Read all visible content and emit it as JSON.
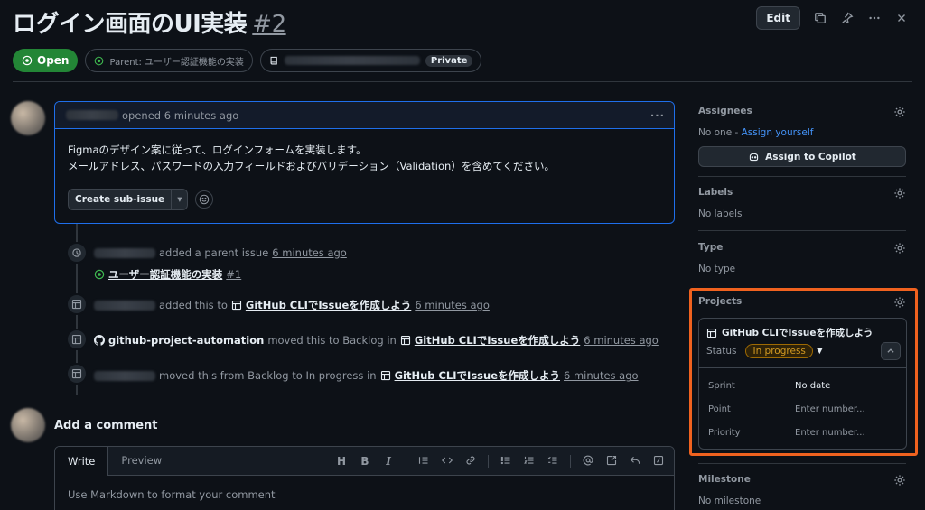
{
  "issue": {
    "title": "ログイン画面のUI実装",
    "number": "#2",
    "state": "Open",
    "parent_label": "Parent: ユーザー認証機能の実装",
    "repo_visibility": "Private"
  },
  "header_actions": {
    "edit_label": "Edit"
  },
  "comment": {
    "opened_text": "opened 6 minutes ago",
    "body_line1": "Figmaのデザイン案に従って、ログインフォームを実装します。",
    "body_line2": "メールアドレス、パスワードの入力フィールドおよびバリデーション（Validation）を含めてください。",
    "create_sub_issue_label": "Create sub-issue"
  },
  "timeline": [
    {
      "action": "added a parent issue",
      "time": "6 minutes ago",
      "sub_link": "ユーザー認証機能の実装",
      "sub_num": "#1"
    },
    {
      "action": "added this to",
      "project": "GitHub CLIでIssueを作成しよう",
      "time": "6 minutes ago"
    },
    {
      "actor": "github-project-automation",
      "action": "moved this to Backlog in",
      "project": "GitHub CLIでIssueを作成しよう",
      "time": "6 minutes ago"
    },
    {
      "action": "moved this from Backlog to In progress in",
      "project": "GitHub CLIでIssueを作成しよう",
      "time": "6 minutes ago"
    }
  ],
  "add_comment": {
    "title": "Add a comment",
    "tab_write": "Write",
    "tab_preview": "Preview",
    "placeholder": "Use Markdown to format your comment",
    "tool_heading": "H",
    "tool_bold": "B",
    "tool_italic": "I"
  },
  "sidebar": {
    "assignees": {
      "title": "Assignees",
      "none_text": "No one - ",
      "assign_link": "Assign yourself",
      "copilot_btn": "Assign to Copilot"
    },
    "labels": {
      "title": "Labels",
      "value": "No labels"
    },
    "type": {
      "title": "Type",
      "value": "No type"
    },
    "projects": {
      "title": "Projects",
      "project_name": "GitHub CLIでIssueを作成しよう",
      "status_label": "Status",
      "status_value": "In progress",
      "status_color": "#d29922",
      "fields": [
        {
          "name": "Sprint",
          "value": "No date"
        },
        {
          "name": "Point",
          "value": "Enter number..."
        },
        {
          "name": "Priority",
          "value": "Enter number..."
        }
      ]
    },
    "milestone": {
      "title": "Milestone",
      "value": "No milestone"
    }
  },
  "colors": {
    "open_green": "#238636",
    "link_blue": "#4493f8",
    "highlight_orange": "#f0621f"
  }
}
